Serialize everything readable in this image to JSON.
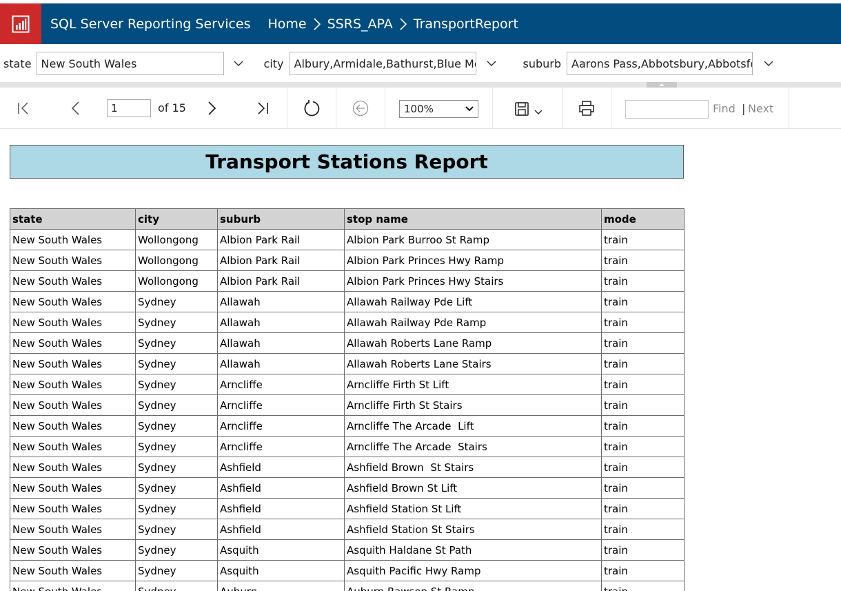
{
  "header": {
    "app_title": "SQL Server Reporting Services",
    "breadcrumbs": [
      "Home",
      "SSRS_APA",
      "TransportReport"
    ],
    "logo_color": "#cc2a2a",
    "bar_color": "#024c80"
  },
  "params": {
    "state_label": "state",
    "state_value": "New South Wales",
    "city_label": "city",
    "city_value": "Albury,Armidale,Bathurst,Blue Moui",
    "suburb_label": "suburb",
    "suburb_value": "Aarons Pass,Abbotsbury,Abbotsforc"
  },
  "toolbar": {
    "page_value": "1",
    "page_of": "of 15",
    "zoom_value": "100%",
    "find_label": "Find",
    "find_sep": "|",
    "next_label": "Next",
    "icons": [
      "first-page-icon",
      "prev-page-icon",
      "next-page-icon",
      "last-page-icon",
      "refresh-icon",
      "back-icon",
      "save-icon",
      "print-icon"
    ]
  },
  "report": {
    "title": "Transport Stations Report",
    "title_bg": "#add8e6",
    "columns": [
      "state",
      "city",
      "suburb",
      "stop name",
      "mode"
    ],
    "rows": [
      [
        "New South Wales",
        "Wollongong",
        "Albion Park Rail",
        "Albion Park Burroo St Ramp",
        "train"
      ],
      [
        "New South Wales",
        "Wollongong",
        "Albion Park Rail",
        "Albion Park Princes Hwy Ramp",
        "train"
      ],
      [
        "New South Wales",
        "Wollongong",
        "Albion Park Rail",
        "Albion Park Princes Hwy Stairs",
        "train"
      ],
      [
        "New South Wales",
        "Sydney",
        "Allawah",
        "Allawah Railway Pde Lift",
        "train"
      ],
      [
        "New South Wales",
        "Sydney",
        "Allawah",
        "Allawah Railway Pde Ramp",
        "train"
      ],
      [
        "New South Wales",
        "Sydney",
        "Allawah",
        "Allawah Roberts Lane Ramp",
        "train"
      ],
      [
        "New South Wales",
        "Sydney",
        "Allawah",
        "Allawah Roberts Lane Stairs",
        "train"
      ],
      [
        "New South Wales",
        "Sydney",
        "Arncliffe",
        "Arncliffe Firth St Lift",
        "train"
      ],
      [
        "New South Wales",
        "Sydney",
        "Arncliffe",
        "Arncliffe Firth St Stairs",
        "train"
      ],
      [
        "New South Wales",
        "Sydney",
        "Arncliffe",
        "Arncliffe The Arcade  Lift",
        "train"
      ],
      [
        "New South Wales",
        "Sydney",
        "Arncliffe",
        "Arncliffe The Arcade  Stairs",
        "train"
      ],
      [
        "New South Wales",
        "Sydney",
        "Ashfield",
        "Ashfield Brown  St Stairs",
        "train"
      ],
      [
        "New South Wales",
        "Sydney",
        "Ashfield",
        "Ashfield Brown St Lift",
        "train"
      ],
      [
        "New South Wales",
        "Sydney",
        "Ashfield",
        "Ashfield Station St Lift",
        "train"
      ],
      [
        "New South Wales",
        "Sydney",
        "Ashfield",
        "Ashfield Station St Stairs",
        "train"
      ],
      [
        "New South Wales",
        "Sydney",
        "Asquith",
        "Asquith Haldane St Path",
        "train"
      ],
      [
        "New South Wales",
        "Sydney",
        "Asquith",
        "Asquith Pacific Hwy Ramp",
        "train"
      ],
      [
        "New South Wales",
        "Sydney",
        "Auburn",
        "Auburn Rawson St Ramp",
        "train"
      ]
    ]
  }
}
